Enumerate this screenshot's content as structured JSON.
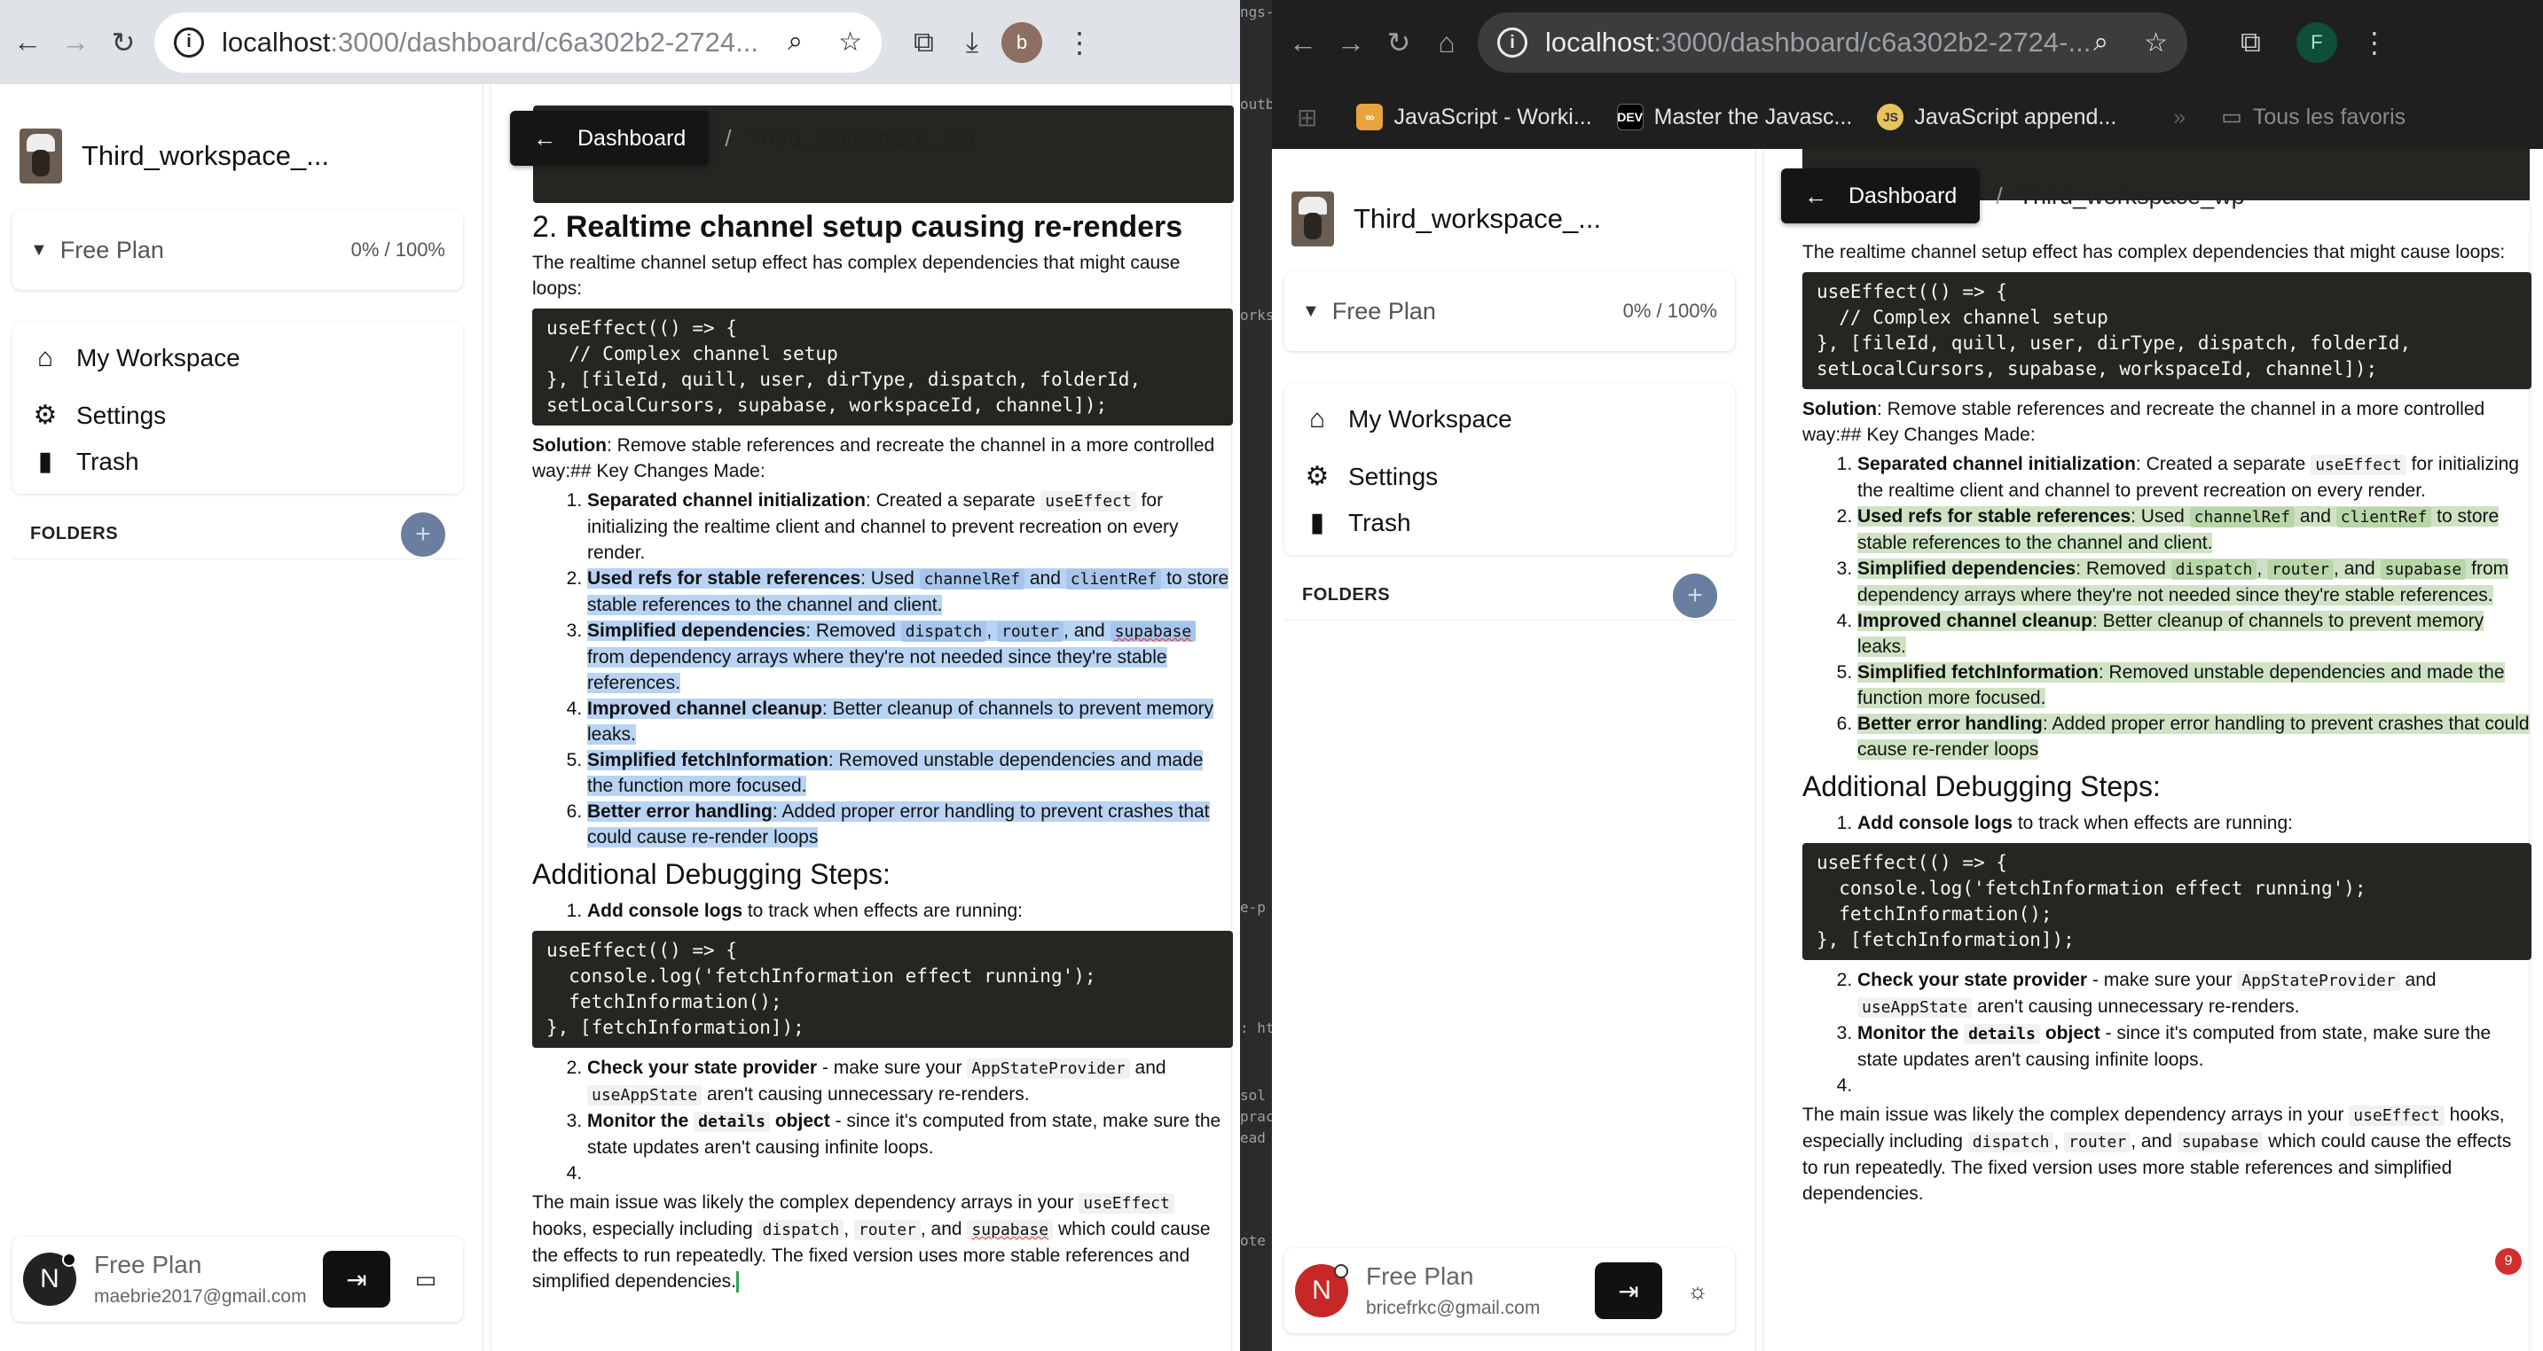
{
  "left_window": {
    "url_host": "localhost",
    "url_path": ":3000/dashboard/c6a302b2-2724...",
    "profile_initial": "b",
    "workspace": {
      "name": "Third_workspace_..."
    },
    "plan": {
      "name": "Free Plan",
      "usage": "0% / 100%"
    },
    "nav": {
      "my_workspace": "My Workspace",
      "settings": "Settings",
      "trash": "Trash"
    },
    "folders_label": "FOLDERS",
    "user": {
      "initial": "N",
      "plan": "Free Plan",
      "email": "maebrie2017@gmail.com"
    },
    "breadcrumb": {
      "dashboard": "Dashboard",
      "separator": "/",
      "workspace": "Third_workspace_wp"
    }
  },
  "right_window": {
    "url_host": "localhost",
    "url_path": ":3000/dashboard/c6a302b2-2724-...",
    "profile_initial": "F",
    "bookmarks": [
      {
        "label": "JavaScript - Worki..."
      },
      {
        "label": "Master the Javasc..."
      },
      {
        "label": "JavaScript append..."
      }
    ],
    "all_bookmarks": "Tous les favoris",
    "workspace": {
      "name": "Third_workspace_..."
    },
    "plan": {
      "name": "Free Plan",
      "usage": "0% / 100%"
    },
    "nav": {
      "my_workspace": "My Workspace",
      "settings": "Settings",
      "trash": "Trash"
    },
    "folders_label": "FOLDERS",
    "user": {
      "initial": "N",
      "plan": "Free Plan",
      "email": "bricefrkc@gmail.com"
    },
    "breadcrumb": {
      "dashboard": "Dashboard",
      "separator": "/",
      "workspace": "Third_workspace_wp"
    },
    "notification_count": "9"
  },
  "gap_text": [
    "ngs-",
    "outb",
    "orks",
    "e-p",
    ": ht",
    "sol",
    "prac",
    "ead",
    "ote"
  ],
  "doc": {
    "h2_num": "2.",
    "h2_title": "Realtime channel setup causing re-renders",
    "intro": "The realtime channel setup effect has complex dependencies that might cause loops:",
    "code1": "useEffect(() => {\n  // Complex channel setup\n}, [fileId, quill, user, dirType, dispatch, folderId,\nsetLocalCursors, supabase, workspaceId, channel]);",
    "solution_label": "Solution",
    "solution_text": ": Remove stable references and recreate the channel in a more controlled way:## Key Changes Made:",
    "li1_b": "Separated channel initialization",
    "li1_a": ": Created a separate ",
    "li1_code": "useEffect",
    "li1_c": " for initializing the realtime client and channel to prevent recreation on every render.",
    "li2_b": "Used refs for stable references",
    "li2_a": ": Used ",
    "li2_code1": "channelRef",
    "li2_and": " and ",
    "li2_code2": "clientRef",
    "li2_c": " to store stable references to the channel and client.",
    "li3_b": "Simplified dependencies",
    "li3_a": ": Removed ",
    "li3_code1": "dispatch",
    "li3_comma": ", ",
    "li3_code2": "router",
    "li3_and": ", and ",
    "li3_code3": "supabase",
    "li3_c": " from dependency arrays where they're not needed since they're stable references.",
    "li4_b": "Improved channel cleanup",
    "li4_c": ": Better cleanup of channels to prevent memory leaks.",
    "li5_b": "Simplified fetchInformation",
    "li5_c": ": Removed unstable dependencies and made the function more focused.",
    "li6_b": "Better error handling",
    "li6_c_left": ": Added proper error handling to prevent crashes that could cause re-render loops",
    "li6_c_right": ": Added proper error handling to prevent crashes that could cause re-render loops",
    "h3": "Additional Debugging Steps:",
    "d1_b": "Add console logs",
    "d1_c": " to track when effects are running:",
    "code2": "useEffect(() => {\n  console.log('fetchInformation effect running');\n  fetchInformation();\n}, [fetchInformation]);",
    "d2_b": "Check your state provider",
    "d2_a": " - make sure your ",
    "d2_code1": "AppStateProvider",
    "d2_and": " and ",
    "d2_code2": "useAppState",
    "d2_c": " aren't causing unnecessary re-renders.",
    "d3_b": "Monitor the ",
    "d3_code": "details",
    "d3_b2": " object",
    "d3_c": " - since it's computed from state, make sure the state updates aren't causing infinite loops.",
    "final_a": "The main issue was likely the complex dependency arrays in your ",
    "final_code1": "useEffect",
    "final_b": " hooks, especially including ",
    "final_code2": "dispatch",
    "final_comma": ", ",
    "final_code3": "router",
    "final_and": ", and ",
    "final_code4": "supabase",
    "final_c": " which could cause the effects to run repeatedly. The fixed version uses more stable references and simplified dependencies."
  }
}
